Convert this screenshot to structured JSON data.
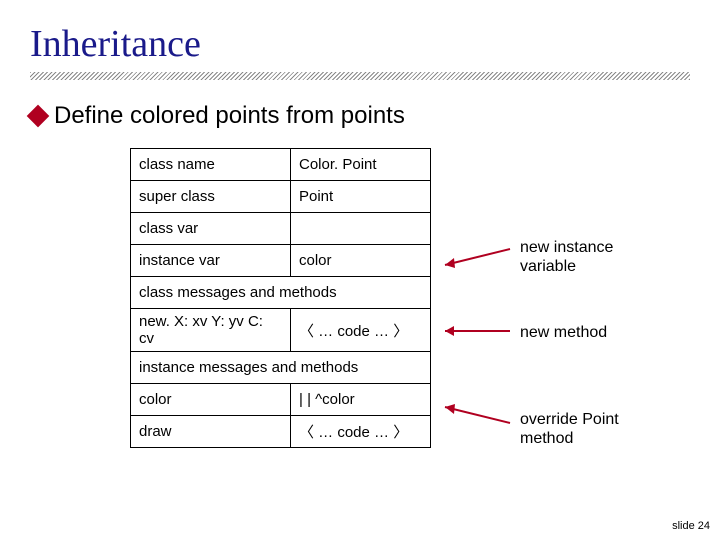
{
  "title": "Inheritance",
  "bullet": "Define colored points from points",
  "table": {
    "rows": [
      {
        "c1": "class name",
        "c2": "Color. Point"
      },
      {
        "c1": "super class",
        "c2": "Point"
      },
      {
        "c1": "class var",
        "c2": ""
      },
      {
        "c1": "instance var",
        "c2": "color"
      }
    ],
    "section1": "class messages and methods",
    "row5": {
      "c1": "new. X: xv Y: yv C: cv",
      "c2": "〈 … code … 〉"
    },
    "section2": "instance messages and methods",
    "row7": {
      "c1": "color",
      "c2": "| | ^color"
    },
    "row8": {
      "c1": "draw",
      "c2": "〈 … code … 〉"
    }
  },
  "annotations": {
    "a1": "new instance\nvariable",
    "a2": "new method",
    "a3": "override Point\nmethod"
  },
  "slide_num": "slide 24"
}
